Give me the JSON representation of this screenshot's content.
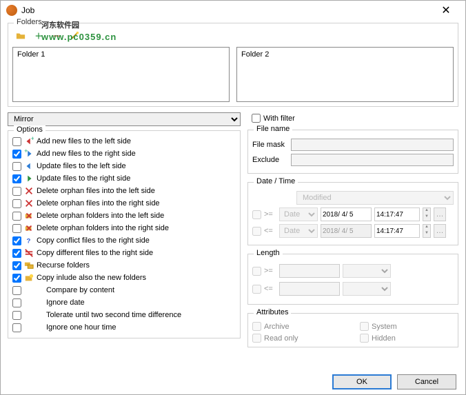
{
  "title": "Job",
  "watermark": {
    "main": "河东软件园",
    "url": "www.pc0359.cn"
  },
  "folders": {
    "label": "Folders",
    "f1": "Folder 1",
    "f2": "Folder 2"
  },
  "mode": "Mirror",
  "options_label": "Options",
  "options": [
    {
      "checked": false,
      "icon": "add-left",
      "label": "Add new files to the left side"
    },
    {
      "checked": true,
      "icon": "add-right",
      "label": "Add new files to the right side"
    },
    {
      "checked": false,
      "icon": "upd-left",
      "label": "Update files to the left side"
    },
    {
      "checked": true,
      "icon": "upd-right",
      "label": "Update files to the right side"
    },
    {
      "checked": false,
      "icon": "del-file-l",
      "label": "Delete orphan files into the left side"
    },
    {
      "checked": false,
      "icon": "del-file-r",
      "label": "Delete orphan files into the right side"
    },
    {
      "checked": false,
      "icon": "del-fold-l",
      "label": "Delete orphan folders into the left side"
    },
    {
      "checked": false,
      "icon": "del-fold-r",
      "label": "Delete orphan folders into the right side"
    },
    {
      "checked": true,
      "icon": "conflict",
      "label": "Copy conflict files to the right side"
    },
    {
      "checked": true,
      "icon": "diff",
      "label": "Copy different files to the right side"
    },
    {
      "checked": true,
      "icon": "recurse",
      "label": "Recurse folders"
    },
    {
      "checked": true,
      "icon": "newfold",
      "label": "Copy inlude also the new folders"
    },
    {
      "checked": false,
      "icon": "",
      "label": "Compare by content"
    },
    {
      "checked": false,
      "icon": "",
      "label": "Ignore date"
    },
    {
      "checked": false,
      "icon": "",
      "label": "Tolerate until two second time difference"
    },
    {
      "checked": false,
      "icon": "",
      "label": "Ignore one hour time"
    }
  ],
  "with_filter": "With filter",
  "filename": {
    "label": "File name",
    "mask": "File mask",
    "exclude": "Exclude"
  },
  "datetime": {
    "label": "Date / Time",
    "kind": "Modified",
    "ge": ">=",
    "le": "<=",
    "date_sel": "Date",
    "date_val": "2018/ 4/ 5",
    "time_val": "14:17:47"
  },
  "length": {
    "label": "Length",
    "ge": ">=",
    "le": "<="
  },
  "attributes": {
    "label": "Attributes",
    "archive": "Archive",
    "system": "System",
    "readonly": "Read only",
    "hidden": "Hidden"
  },
  "buttons": {
    "ok": "OK",
    "cancel": "Cancel"
  }
}
